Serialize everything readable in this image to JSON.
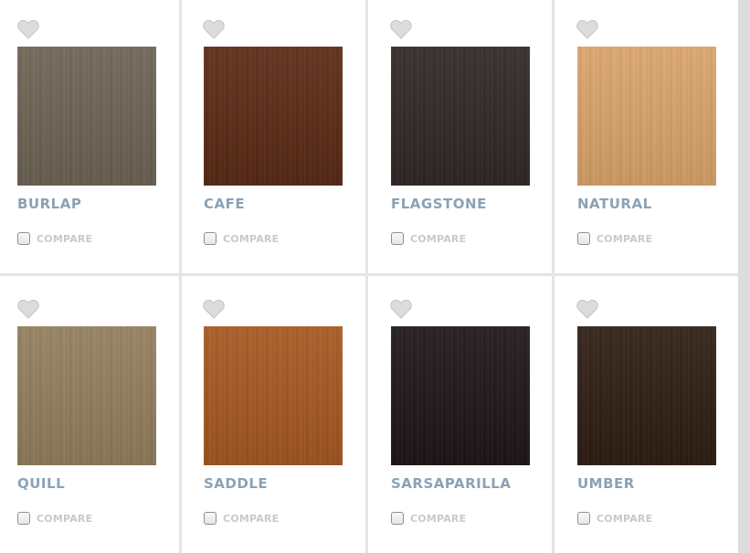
{
  "finishes": [
    {
      "name": "BURLAP",
      "compare_label": "COMPARE",
      "color": "#6e6455",
      "icon": "heart-icon"
    },
    {
      "name": "CAFE",
      "compare_label": "COMPARE",
      "color": "#5a2a14",
      "icon": "heart-icon"
    },
    {
      "name": "FLAGSTONE",
      "compare_label": "COMPARE",
      "color": "#2f2725",
      "icon": "heart-icon"
    },
    {
      "name": "NATURAL",
      "compare_label": "COMPARE",
      "color": "#dca56a",
      "icon": "heart-icon"
    },
    {
      "name": "QUILL",
      "compare_label": "COMPARE",
      "color": "#947f5d",
      "icon": "heart-icon"
    },
    {
      "name": "SADDLE",
      "compare_label": "COMPARE",
      "color": "#a75820",
      "icon": "heart-icon"
    },
    {
      "name": "SARSAPARILLA",
      "compare_label": "COMPARE",
      "color": "#1d1516",
      "icon": "heart-icon"
    },
    {
      "name": "UMBER",
      "compare_label": "COMPARE",
      "color": "#2e1d12",
      "icon": "heart-icon"
    }
  ],
  "colors": {
    "name_text": "#8aa2b6",
    "compare_text": "#c9c9c9",
    "divider": "#e4e4e4"
  }
}
